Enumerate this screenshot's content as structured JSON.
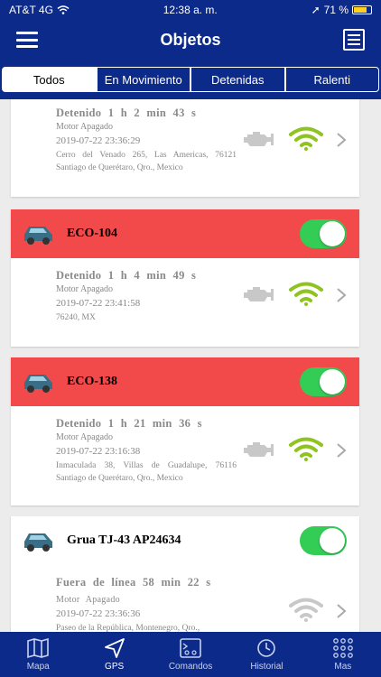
{
  "status": {
    "carrier": "AT&T 4G",
    "time": "12:38 a. m.",
    "battery": "71 %"
  },
  "header": {
    "title": "Objetos"
  },
  "tabs": [
    {
      "label": "Todos",
      "active": true
    },
    {
      "label": "En Movimiento",
      "active": false
    },
    {
      "label": "Detenidas",
      "active": false
    },
    {
      "label": "Ralenti",
      "active": false
    }
  ],
  "cards": [
    {
      "name": "",
      "state": "Detenido 1 h 2 min 43 s",
      "motor": "Motor Apagado",
      "date": "2019-07-22 23:36:29",
      "address": "Cerro del Venado 265, Las Americas, 76121 Santiago de Querétaro, Qro., Mexico",
      "wifi_color": "#8fc31f"
    },
    {
      "name": "ECO-104",
      "alert": true,
      "toggle_on": true,
      "state": "Detenido 1 h 4 min 49 s",
      "motor": "Motor Apagado",
      "date": "2019-07-22 23:41:58",
      "address": "76240, MX",
      "wifi_color": "#8fc31f"
    },
    {
      "name": "ECO-138",
      "alert": true,
      "toggle_on": true,
      "state": "Detenido 1 h 21 min 36 s",
      "motor": "Motor Apagado",
      "date": "2019-07-22 23:16:38",
      "address": "Inmaculada 38, Villas de Guadalupe, 76116 Santiago de Querétaro, Qro., Mexico",
      "wifi_color": "#8fc31f"
    },
    {
      "name": "Grua TJ-43 AP24634",
      "alert": false,
      "toggle_on": true,
      "state": "Fuera de línea 58 min 22 s",
      "motor": "Motor Apagado",
      "date": "2019-07-22 23:36:36",
      "address": "Paseo de la República, Montenegro, Qro.,",
      "wifi_color": "#c8c8c8"
    }
  ],
  "nav": [
    {
      "label": "Mapa",
      "icon": "map-icon",
      "active": false
    },
    {
      "label": "GPS",
      "icon": "location-arrow-icon",
      "active": true
    },
    {
      "label": "Comandos",
      "icon": "commands-icon",
      "active": false
    },
    {
      "label": "Historial",
      "icon": "history-icon",
      "active": false
    },
    {
      "label": "Mas",
      "icon": "grid-icon",
      "active": false
    }
  ],
  "colors": {
    "brand": "#0c2a8a",
    "alert": "#f24a4a",
    "toggle": "#33cc55",
    "engine": "#c8c8c8"
  }
}
